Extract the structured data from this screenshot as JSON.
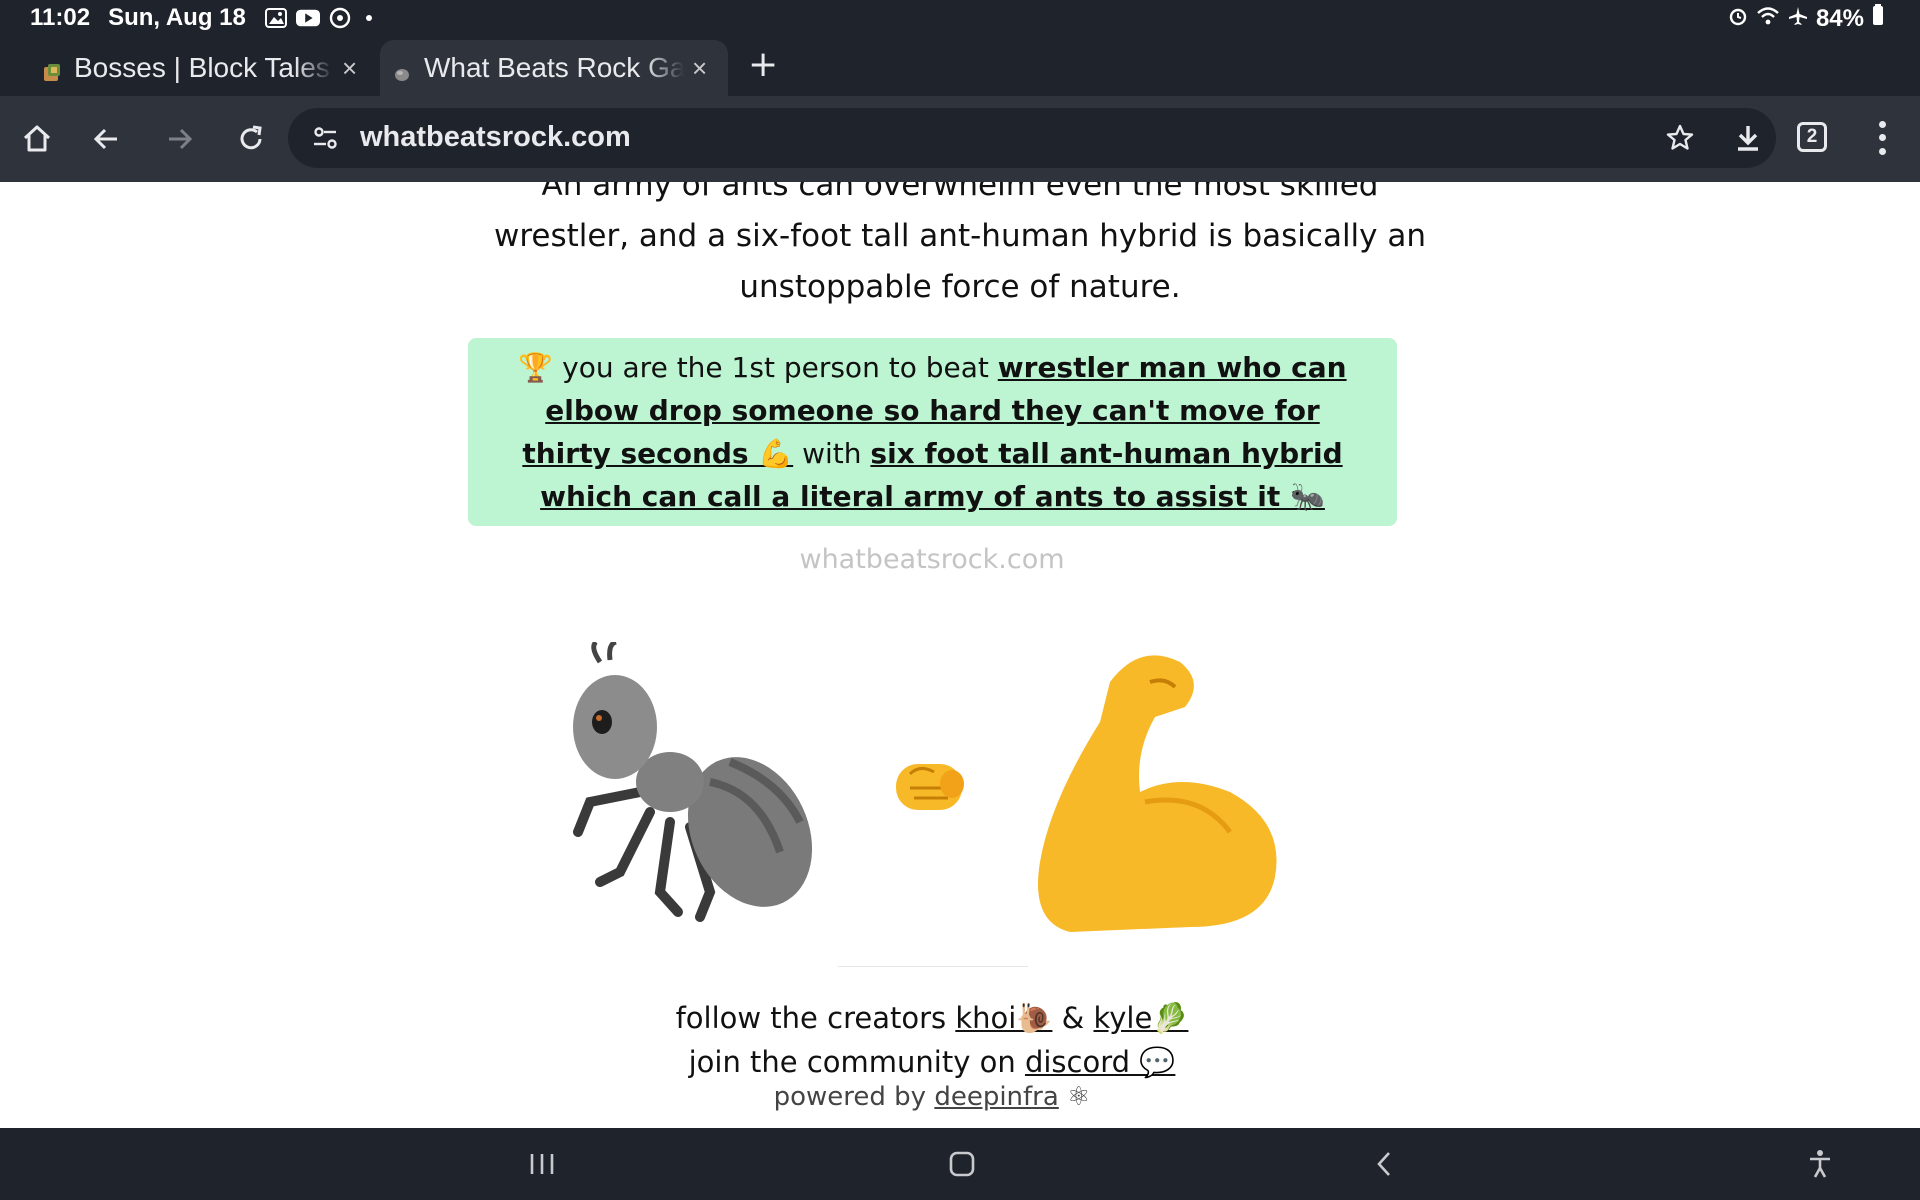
{
  "status_bar": {
    "time": "11:02",
    "date": "Sun, Aug 18",
    "battery": "84%"
  },
  "tabs": [
    {
      "title": "Bosses | Block Tales",
      "close": "×"
    },
    {
      "title": "What Beats Rock Game",
      "close": "×"
    }
  ],
  "new_tab_label": "+",
  "omnibox": {
    "url": "whatbeatsrock.com"
  },
  "tab_count": "2",
  "page": {
    "explanation_lines": [
      "An army of ants can overwhelm even the most skilled",
      "wrestler, and a six-foot tall ant-human hybrid is basically an",
      "unstoppable force of nature."
    ],
    "result": {
      "prefix": "🏆 you are the 1st person to beat ",
      "beaten": "wrestler man who can elbow drop someone so hard they can't move for thirty seconds 💪",
      "middle": " with ",
      "winner": "six foot tall ant-human hybrid which can call a literal army of ants to assist it 🐜"
    },
    "watermark": "whatbeatsrock.com",
    "footer": {
      "follow_prefix": "follow the creators ",
      "creator_1": "khoi🐌",
      "amp": " & ",
      "creator_2": "kyle🥬",
      "community_prefix": "join the community on ",
      "discord": "discord 💬",
      "powered_prefix": "powered by ",
      "powered_link": "deepinfra",
      "powered_suffix": " ⚛"
    }
  },
  "colors": {
    "chrome_dark": "#1f232b",
    "chrome_toolbar": "#2f333b",
    "result_bg": "#bdf5d3",
    "watermark": "#c4c4c4"
  }
}
